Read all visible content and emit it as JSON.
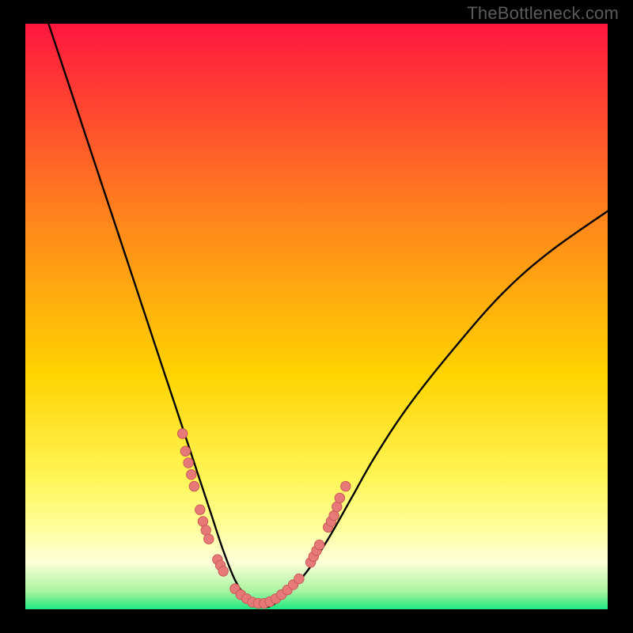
{
  "watermark": "TheBottleneck.com",
  "colors": {
    "bg_black": "#000000",
    "grad_top": "#ff163f",
    "grad_mid1": "#ff6a1f",
    "grad_mid2": "#ffd400",
    "grad_low1": "#ffff66",
    "grad_low2": "#fdffd0",
    "grad_bottom": "#1ee881",
    "curve": "#000000",
    "dot_fill": "#e77a78",
    "dot_stroke": "#c95955"
  },
  "chart_data": {
    "type": "line",
    "title": "",
    "xlabel": "",
    "ylabel": "",
    "xlim": [
      0,
      100
    ],
    "ylim": [
      0,
      100
    ],
    "series": [
      {
        "name": "bottleneck-curve",
        "x": [
          4,
          8,
          12,
          16,
          20,
          24,
          26,
          28,
          30,
          32,
          34,
          36,
          38,
          40,
          42,
          44,
          48,
          52,
          56,
          60,
          66,
          74,
          82,
          90,
          100
        ],
        "y": [
          100,
          88,
          76,
          64,
          52,
          40,
          34,
          28,
          22,
          16,
          10,
          5,
          2,
          0.5,
          0.5,
          2,
          6,
          12,
          19,
          26,
          35,
          45,
          54,
          61,
          68
        ]
      }
    ],
    "scatter": [
      {
        "name": "dots",
        "points": [
          [
            27,
            30
          ],
          [
            27.5,
            27
          ],
          [
            28,
            25
          ],
          [
            28.5,
            23
          ],
          [
            29,
            21
          ],
          [
            30,
            17
          ],
          [
            30.5,
            15
          ],
          [
            31,
            13.5
          ],
          [
            31.5,
            12
          ],
          [
            33,
            8.5
          ],
          [
            33.5,
            7.5
          ],
          [
            34,
            6.5
          ],
          [
            36,
            3.5
          ],
          [
            37,
            2.5
          ],
          [
            38,
            1.8
          ],
          [
            39,
            1.2
          ],
          [
            40,
            1.0
          ],
          [
            41,
            1.0
          ],
          [
            42,
            1.3
          ],
          [
            43,
            1.8
          ],
          [
            44,
            2.5
          ],
          [
            45,
            3.3
          ],
          [
            46,
            4.2
          ],
          [
            47,
            5.2
          ],
          [
            49,
            8
          ],
          [
            49.5,
            9
          ],
          [
            50,
            10
          ],
          [
            50.5,
            11
          ],
          [
            52,
            14
          ],
          [
            52.5,
            15
          ],
          [
            53,
            16
          ],
          [
            53.5,
            17.5
          ],
          [
            54,
            19
          ],
          [
            55,
            21
          ]
        ]
      }
    ],
    "gradient_bands": [
      {
        "y": 100,
        "color": "#ff163f"
      },
      {
        "y": 65,
        "color": "#ff8a1a"
      },
      {
        "y": 40,
        "color": "#ffd400"
      },
      {
        "y": 22,
        "color": "#fff65a"
      },
      {
        "y": 14,
        "color": "#ffff9a"
      },
      {
        "y": 8,
        "color": "#fdffd8"
      },
      {
        "y": 3,
        "color": "#a8f4a0"
      },
      {
        "y": 0,
        "color": "#1ee881"
      }
    ]
  }
}
